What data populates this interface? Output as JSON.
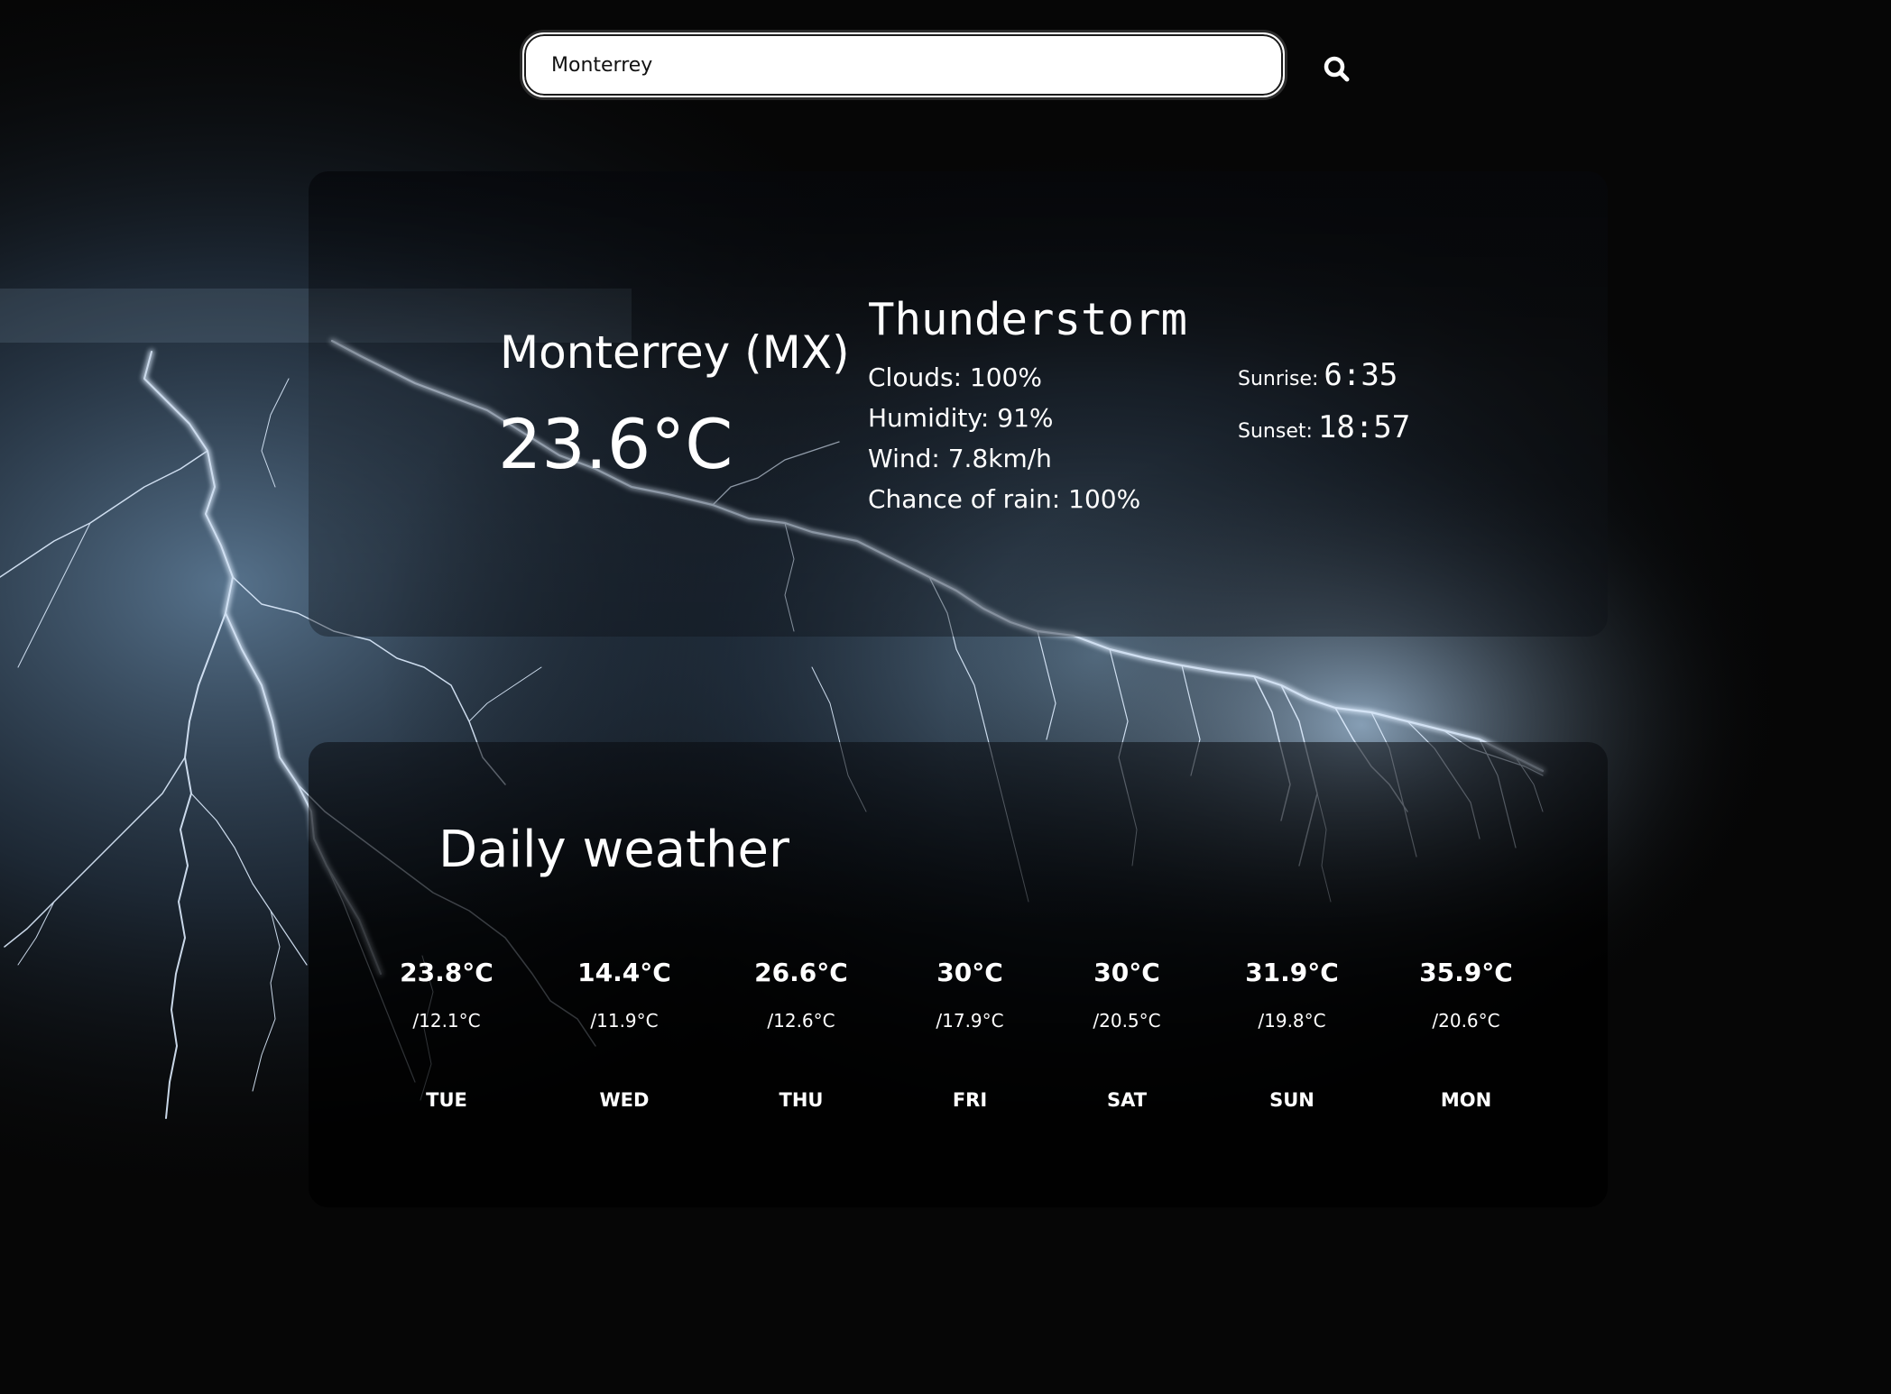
{
  "search": {
    "value": "Monterrey",
    "button_icon": "search-icon"
  },
  "current": {
    "location": "Monterrey (MX)",
    "temperature": "23.6°C",
    "condition": "Thunderstorm",
    "clouds": "Clouds: 100%",
    "humidity": "Humidity: 91%",
    "wind": "Wind: 7.8km/h",
    "rain": "Chance of rain: 100%",
    "sunrise_label": "Sunrise:",
    "sunrise_time": "6:35",
    "sunset_label": "Sunset:",
    "sunset_time": "18:57"
  },
  "daily": {
    "title": "Daily weather",
    "days": [
      {
        "max": "23.8°C",
        "min": "/12.1°C",
        "day": "TUE"
      },
      {
        "max": "14.4°C",
        "min": "/11.9°C",
        "day": "WED"
      },
      {
        "max": "26.6°C",
        "min": "/12.6°C",
        "day": "THU"
      },
      {
        "max": "30°C",
        "min": "/17.9°C",
        "day": "FRI"
      },
      {
        "max": "30°C",
        "min": "/20.5°C",
        "day": "SAT"
      },
      {
        "max": "31.9°C",
        "min": "/19.8°C",
        "day": "SUN"
      },
      {
        "max": "35.9°C",
        "min": "/20.6°C",
        "day": "MON"
      }
    ]
  },
  "colors": {
    "background": "#060606",
    "text": "#ffffff",
    "lightning": "#dfeeff",
    "glow": "#5d7a96"
  }
}
